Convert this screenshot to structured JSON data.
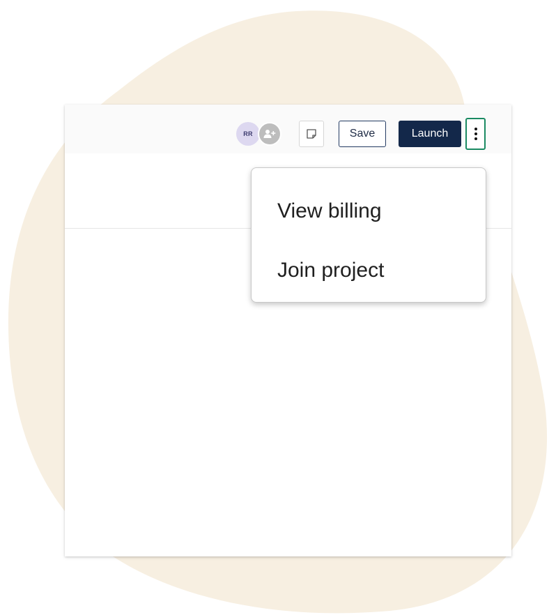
{
  "colors": {
    "background_blob": "#f7efe1",
    "launch_bg": "#13284a",
    "more_border": "#1a8a62",
    "avatar_bg": "#ddd8f0"
  },
  "toolbar": {
    "avatar_initials": "RR",
    "add_user_icon": "add-user-icon",
    "note_icon": "sticky-note-icon",
    "save_label": "Save",
    "launch_label": "Launch",
    "more_icon": "vertical-ellipsis-icon"
  },
  "menu": {
    "items": [
      {
        "label": "View billing"
      },
      {
        "label": "Join project"
      }
    ]
  }
}
